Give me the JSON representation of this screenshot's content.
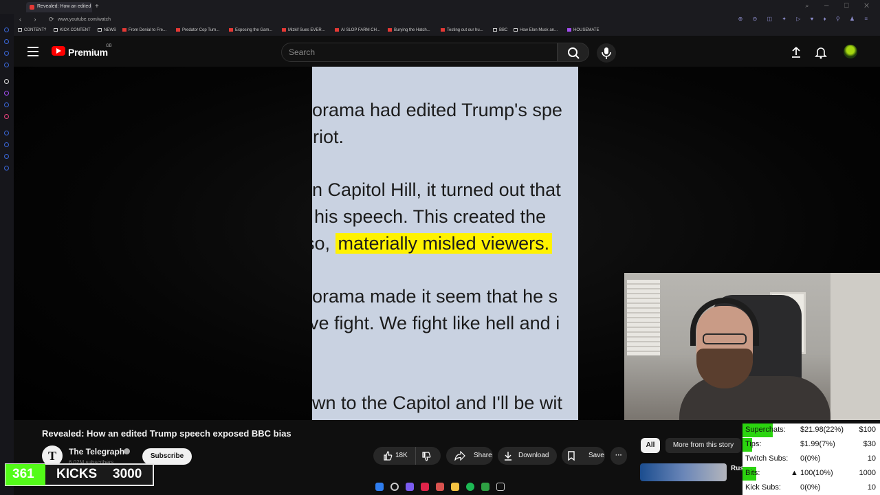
{
  "browser": {
    "tab_title": "Revealed: How an edited",
    "new_tab": "+",
    "url": "www.youtube.com/watch",
    "bookmarks": [
      "CONTENT?",
      "KICK CONTENT",
      "NEWS",
      "From Denial to Fre...",
      "Predator Cop Turn...",
      "Exposing the Gam...",
      "Mizkif Sues EVER...",
      "AI SLOP FARM CH...",
      "Burying the Hatch...",
      "Testing out our hu...",
      "BBC",
      "How Elon Musk an...",
      "HOUSEMATE"
    ]
  },
  "header": {
    "brand": "Premium",
    "country": "GB",
    "search_placeholder": "Search"
  },
  "video": {
    "lines": [
      "orama had edited Trump's spe",
      "riot.",
      "n Capitol Hill, it turned out that",
      "his speech. This created the",
      "so, ",
      "materially misled viewers.",
      "orama made it seem that he s",
      "ve fight. We fight like hell and i",
      "wn to the Capitol and I'll be wit"
    ]
  },
  "meta": {
    "title": "Revealed: How an edited Trump speech exposed BBC bias",
    "channel": "The Telegraph",
    "channel_initial": "T",
    "subscribers": "6.02M subscribers",
    "subscribe": "Subscribe",
    "likes": "18K",
    "share": "Share",
    "download": "Download",
    "save": "Save",
    "more": "···"
  },
  "sidebar_chips": {
    "all": "All",
    "more_from_story": "More from this story",
    "rec_title": "Rus"
  },
  "kicks": {
    "count": "361",
    "label": "KICKS",
    "goal": "3000"
  },
  "stats": {
    "rows": [
      {
        "label": "Superchats:",
        "value": "$21.98(22%)",
        "goal": "$100",
        "progress": 0.22
      },
      {
        "label": "Tips:",
        "value": "$1.99(7%)",
        "goal": "$30",
        "progress": 0.07
      },
      {
        "label": "Twitch Subs:",
        "value": "0(0%)",
        "goal": "10",
        "progress": 0
      },
      {
        "label": "Bits:",
        "value": "100(10%)",
        "goal": "1000",
        "progress": 0.1
      },
      {
        "label": "Kick Subs:",
        "value": "0(0%)",
        "goal": "10",
        "progress": 0
      }
    ]
  },
  "colors": {
    "yt_red": "#ff0000",
    "kick_green": "#53fc18",
    "goal_green": "#2bd40f",
    "highlight": "#fff200"
  }
}
